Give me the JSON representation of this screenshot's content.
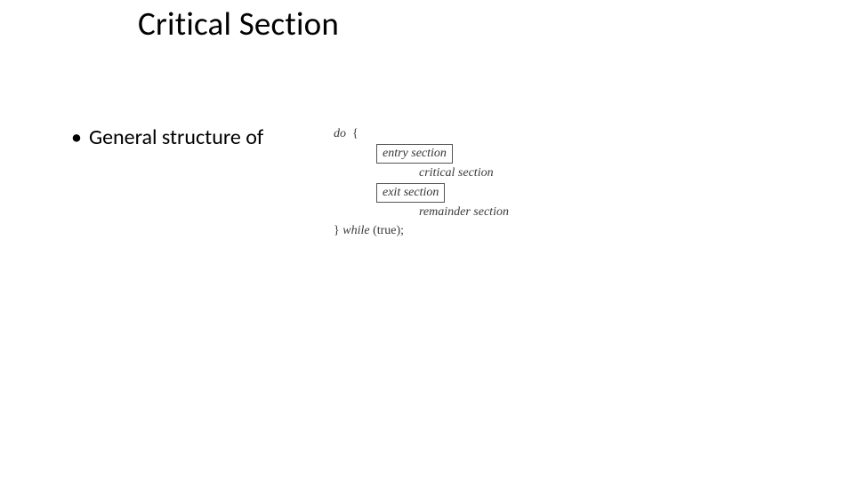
{
  "title": "Critical Section",
  "bullet": {
    "text": "General structure of"
  },
  "code": {
    "do_kw": "do",
    "brace_open": "{",
    "entry": "entry section",
    "critical": "critical section",
    "exit": "exit section",
    "remainder": "remainder section",
    "brace_close": "}",
    "while_kw": "while",
    "cond": "(true);"
  }
}
